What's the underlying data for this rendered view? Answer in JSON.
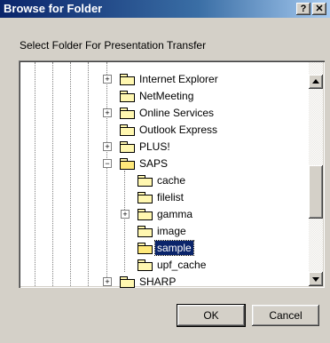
{
  "window": {
    "title": "Browse for Folder",
    "help_label": "?",
    "close_label": "✕"
  },
  "prompt": "Select Folder For Presentation Transfer",
  "tree": {
    "items": [
      {
        "label": "Internet Explorer",
        "expander": "+"
      },
      {
        "label": "NetMeeting",
        "expander": ""
      },
      {
        "label": "Online Services",
        "expander": "+"
      },
      {
        "label": "Outlook Express",
        "expander": ""
      },
      {
        "label": "PLUS!",
        "expander": "+"
      },
      {
        "label": "SAPS",
        "expander": "−"
      },
      {
        "label": "cache",
        "expander": ""
      },
      {
        "label": "filelist",
        "expander": ""
      },
      {
        "label": "gamma",
        "expander": "+"
      },
      {
        "label": "image",
        "expander": ""
      },
      {
        "label": "sample",
        "expander": "",
        "selected": true
      },
      {
        "label": "upf_cache",
        "expander": ""
      },
      {
        "label": "SHARP",
        "expander": "+"
      }
    ]
  },
  "buttons": {
    "ok": "OK",
    "cancel": "Cancel"
  }
}
